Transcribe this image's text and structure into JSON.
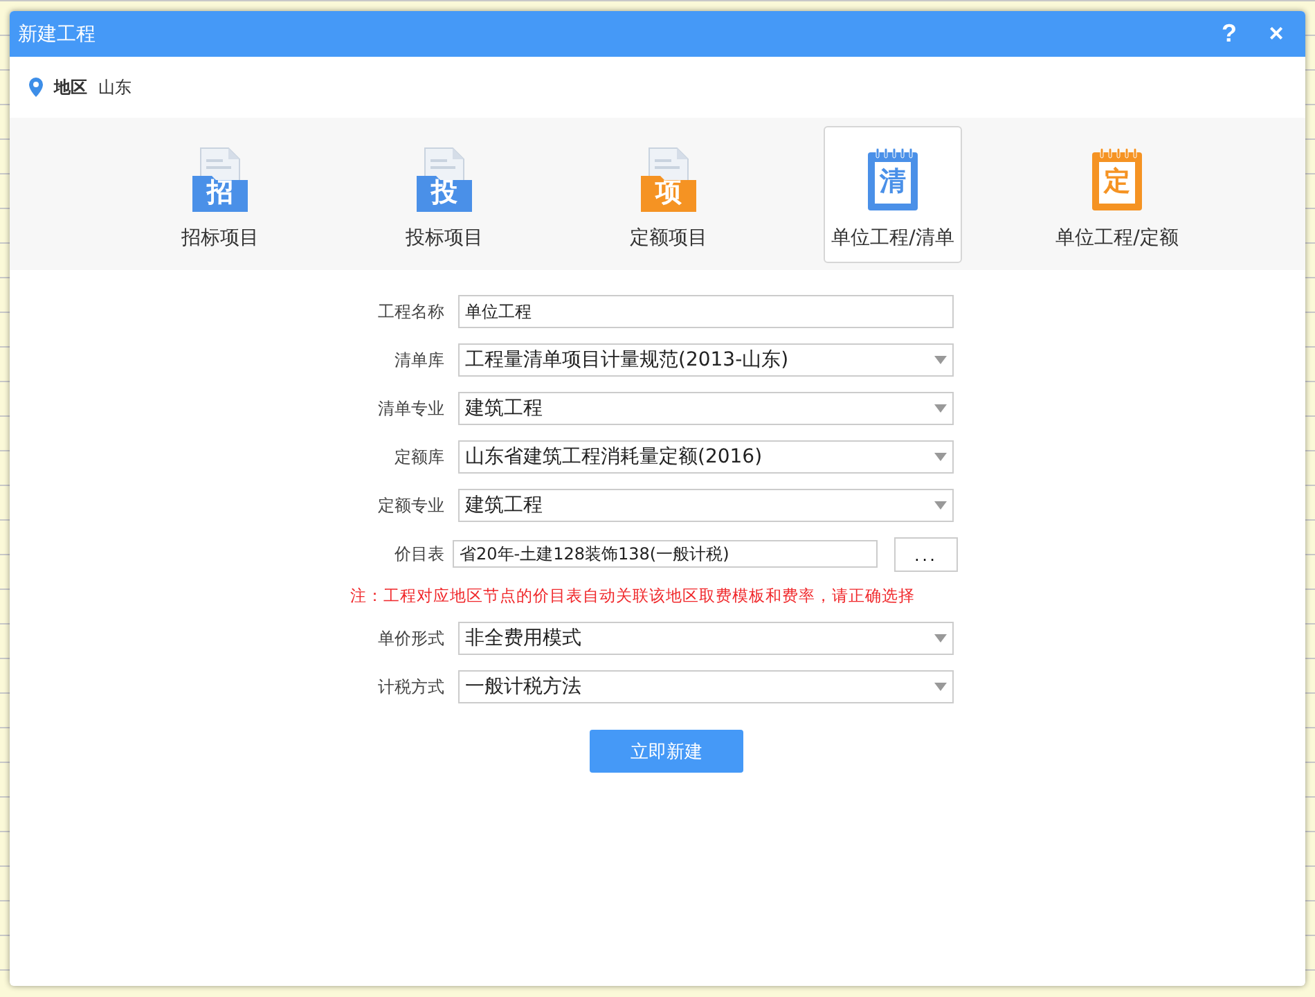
{
  "window": {
    "title": "新建工程",
    "help": "?",
    "close": "×"
  },
  "region": {
    "label": "地区",
    "value": "山东"
  },
  "project_types": [
    {
      "label": "招标项目",
      "badge": "招",
      "color": "#4a90e8",
      "kind": "document",
      "selected": false
    },
    {
      "label": "投标项目",
      "badge": "投",
      "color": "#4a90e8",
      "kind": "document",
      "selected": false
    },
    {
      "label": "定额项目",
      "badge": "项",
      "color": "#f59323",
      "kind": "document",
      "selected": false
    },
    {
      "label": "单位工程/清单",
      "badge": "清",
      "color": "#4a90e8",
      "kind": "notepad",
      "selected": true
    },
    {
      "label": "单位工程/定额",
      "badge": "定",
      "color": "#f59323",
      "kind": "notepad",
      "selected": false
    }
  ],
  "form_top": [
    {
      "label": "工程名称",
      "value": "单位工程",
      "kind": "text"
    },
    {
      "label": "清单库",
      "value": "工程量清单项目计量规范(2013-山东)",
      "kind": "select"
    },
    {
      "label": "清单专业",
      "value": "建筑工程",
      "kind": "select"
    },
    {
      "label": "定额库",
      "value": "山东省建筑工程消耗量定额(2016)",
      "kind": "select"
    },
    {
      "label": "定额专业",
      "value": "建筑工程",
      "kind": "select"
    },
    {
      "label": "价目表",
      "value": "省20年-土建128装饰138(一般计税)",
      "kind": "picker",
      "button": "..."
    }
  ],
  "note": "注：工程对应地区节点的价目表自动关联该地区取费模板和费率，请正确选择",
  "form_bottom": [
    {
      "label": "单价形式",
      "value": "非全费用模式",
      "kind": "select"
    },
    {
      "label": "计税方式",
      "value": "一般计税方法",
      "kind": "select"
    }
  ],
  "submit": "立即新建"
}
